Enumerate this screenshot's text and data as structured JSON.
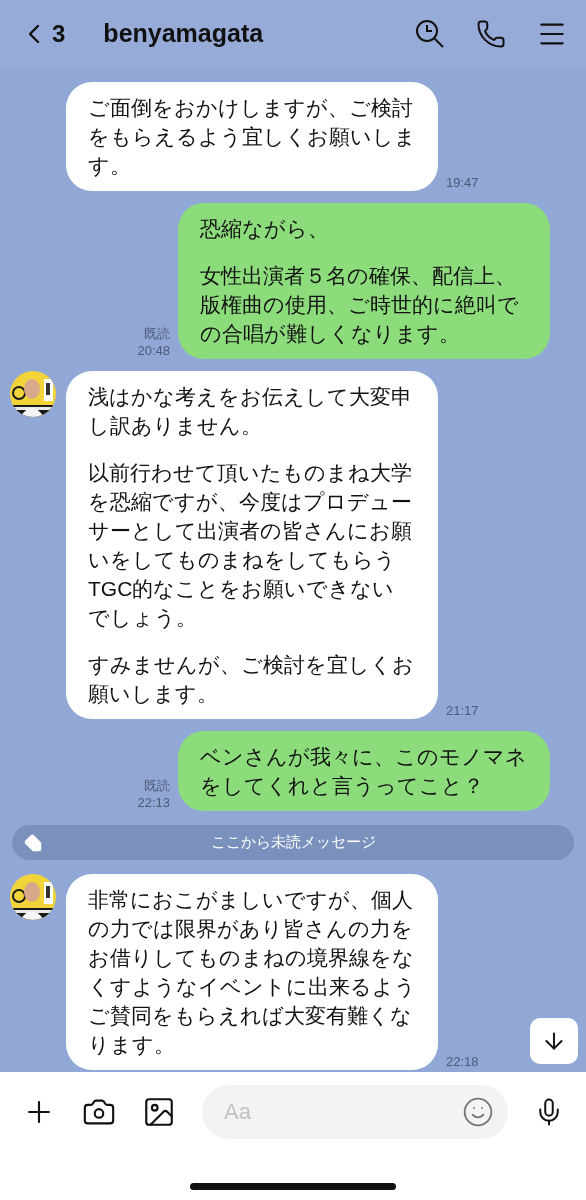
{
  "header": {
    "back_count": "3",
    "title": "benyamagata"
  },
  "items": [
    {
      "kind": "received",
      "avatar": false,
      "paragraphs": [
        "ご面倒をおかけしますが、ご検討をもらえるよう宜しくお願いします。"
      ],
      "time": "19:47"
    },
    {
      "kind": "sent",
      "read_receipt": "既読",
      "paragraphs": [
        "恐縮ながら、",
        "女性出演者５名の確保、配信上、版権曲の使用、ご時世的に絶叫での合唱が難しくなります。"
      ],
      "time": "20:48"
    },
    {
      "kind": "received",
      "avatar": true,
      "paragraphs": [
        "浅はかな考えをお伝えして大変申し訳ありません。",
        "以前行わせて頂いたものまね大学を恐縮ですが、今度はプロデューサーとして出演者の皆さんにお願いをしてものまねをしてもらうTGC的なことをお願いできないでしょう。",
        "すみませんが、ご検討を宜しくお願いします。"
      ],
      "time": "21:17"
    },
    {
      "kind": "sent",
      "read_receipt": "既読",
      "paragraphs": [
        "ベンさんが我々に、このモノマネをしてくれと言うってこと？"
      ],
      "time": "22:13"
    },
    {
      "kind": "divider",
      "text": "ここから未読メッセージ"
    },
    {
      "kind": "received",
      "avatar": true,
      "paragraphs": [
        "非常におこがましいですが、個人の力では限界があり皆さんの力をお借りしてものまねの境界線をなくすようなイベントに出来るようご賛同をもらえれば大変有難くなります。"
      ],
      "time": "22:18"
    }
  ],
  "input": {
    "placeholder": "Aa"
  }
}
